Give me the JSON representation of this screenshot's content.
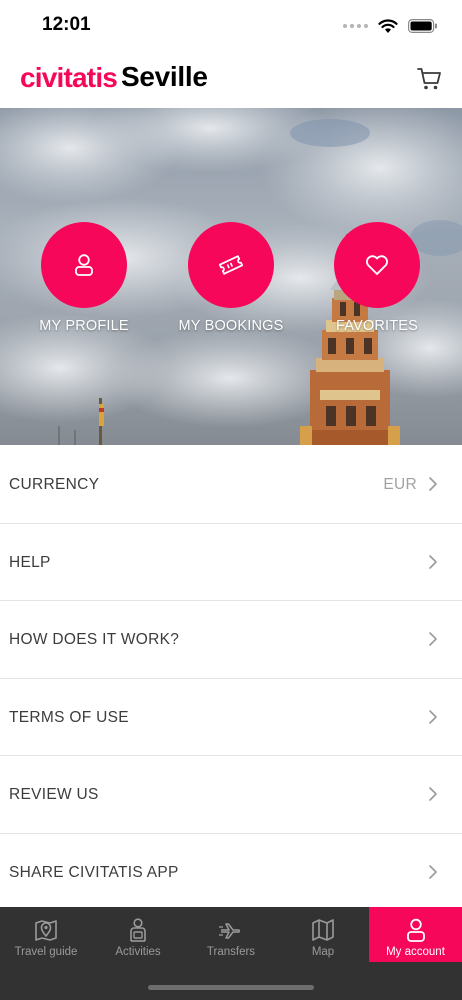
{
  "status_bar": {
    "time": "12:01"
  },
  "header": {
    "brand": "civitatis",
    "city": "Seville"
  },
  "quick_actions": [
    {
      "label": "MY PROFILE",
      "icon": "person-icon"
    },
    {
      "label": "MY BOOKINGS",
      "icon": "ticket-icon"
    },
    {
      "label": "FAVORITES",
      "icon": "heart-icon"
    }
  ],
  "menu": [
    {
      "label": "CURRENCY",
      "value": "EUR"
    },
    {
      "label": "HELP",
      "value": ""
    },
    {
      "label": "HOW DOES IT WORK?",
      "value": ""
    },
    {
      "label": "TERMS OF USE",
      "value": ""
    },
    {
      "label": "REVIEW US",
      "value": ""
    },
    {
      "label": "SHARE CIVITATIS APP",
      "value": ""
    }
  ],
  "tabs": [
    {
      "label": "Travel guide",
      "icon": "map-pin-icon",
      "active": false
    },
    {
      "label": "Activities",
      "icon": "guide-person-icon",
      "active": false
    },
    {
      "label": "Transfers",
      "icon": "airplane-icon",
      "active": false
    },
    {
      "label": "Map",
      "icon": "folded-map-icon",
      "active": false
    },
    {
      "label": "My account",
      "icon": "account-icon",
      "active": true
    }
  ],
  "colors": {
    "brand": "#f70759",
    "tab_bar": "#323232",
    "text": "#3c3c3c",
    "muted": "#a2a2a2"
  }
}
